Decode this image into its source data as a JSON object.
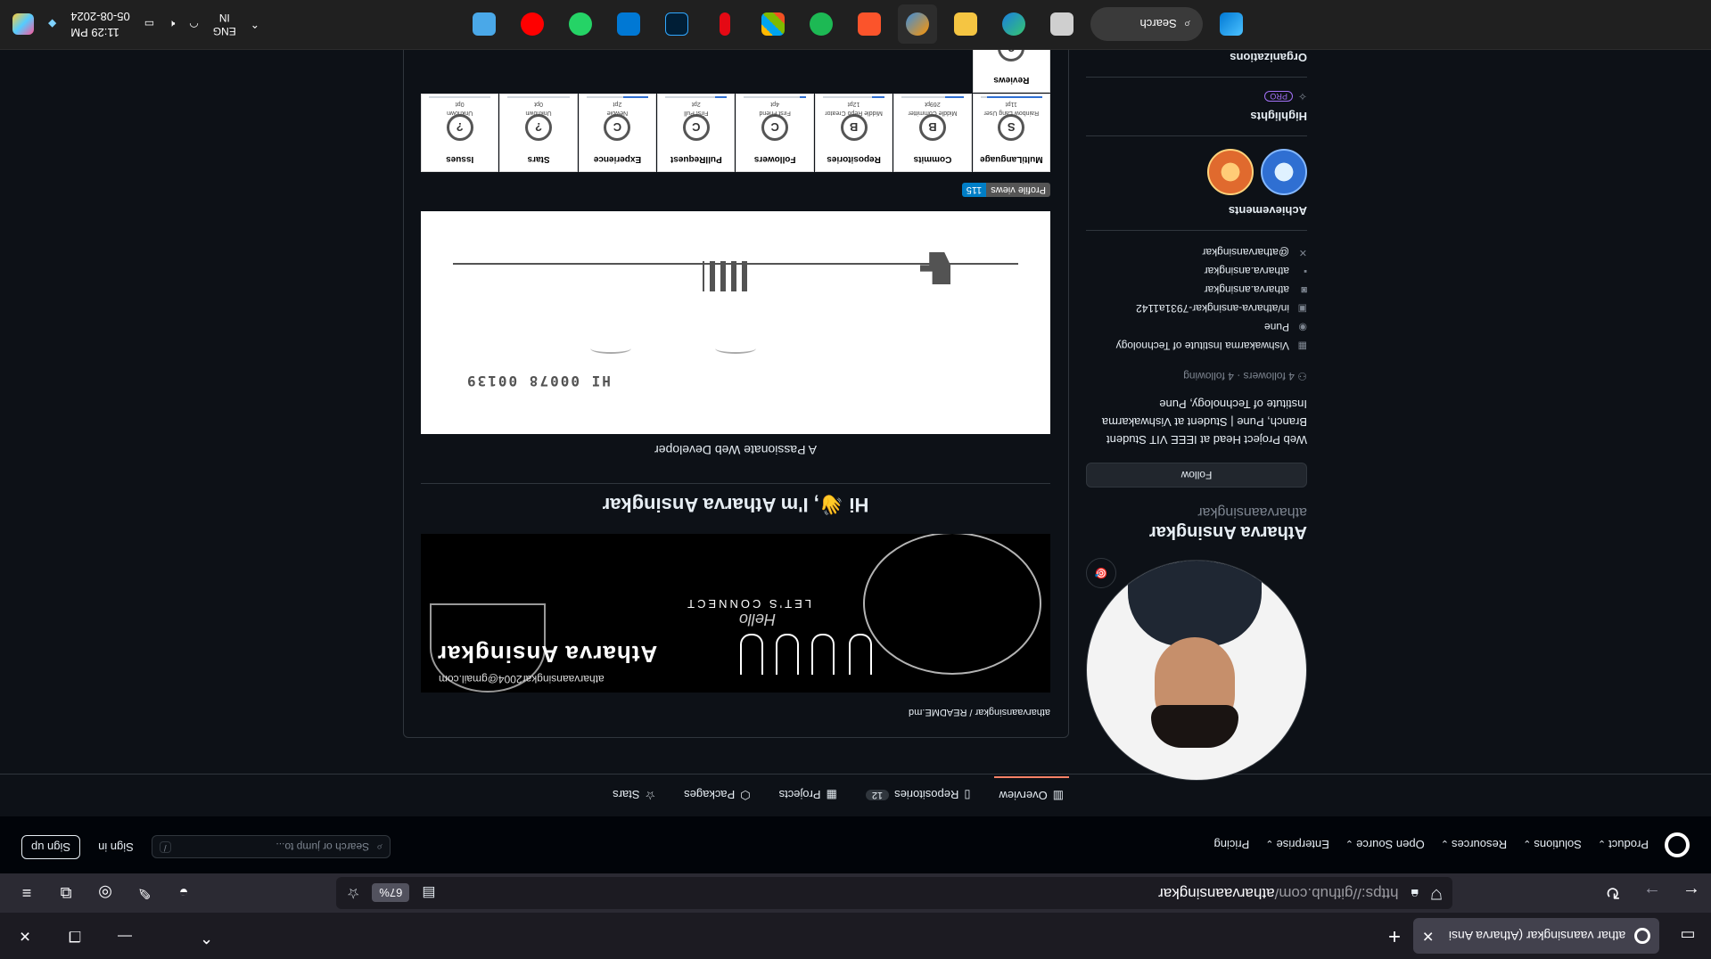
{
  "browser": {
    "tab_title": "athar vaansingkar (Atharva Ansi",
    "tab_close": "✕",
    "new_tab": "+",
    "url_host": "https://github.com/",
    "url_path": "atharvaansingkar",
    "zoom": "67%"
  },
  "github_header": {
    "menu": [
      "Product",
      "Solutions",
      "Resources",
      "Open Source",
      "Enterprise",
      "Pricing"
    ],
    "search_placeholder": "Search or jump to...",
    "search_kbd": "/",
    "sign_in": "Sign in",
    "sign_up": "Sign up"
  },
  "profile_tabs": [
    {
      "label": "Overview",
      "icon": "book-icon"
    },
    {
      "label": "Repositories",
      "icon": "repo-icon",
      "count": "12"
    },
    {
      "label": "Projects",
      "icon": "table-icon"
    },
    {
      "label": "Packages",
      "icon": "package-icon"
    },
    {
      "label": "Stars",
      "icon": "star-icon"
    }
  ],
  "profile": {
    "name": "Atharva Ansingkar",
    "login": "atharvaansingkar",
    "status_emoji": "🎯",
    "follow_label": "Follow",
    "bio": "Web Project Head at IEEE VIT Student Branch, Pune | Student at Vishwakarma Institute of Technology, Pune",
    "followers": "4 followers",
    "following": "4 following",
    "details": [
      {
        "icon": "building-icon",
        "text": "Vishwakarma Institute of Technology"
      },
      {
        "icon": "location-icon",
        "text": "Pune"
      },
      {
        "icon": "linkedin-icon",
        "text": "in/atharva-ansingkar-7931a1142"
      },
      {
        "icon": "instagram-icon",
        "text": "atharva.ansingkar"
      },
      {
        "icon": "facebook-icon",
        "text": "atharva.ansingkar"
      },
      {
        "icon": "x-icon",
        "text": "@atharvansingkar"
      }
    ],
    "achievements_title": "Achievements",
    "highlights_title": "Highlights",
    "pro_label": "PRO",
    "organizations_title": "Organizations"
  },
  "readme": {
    "path": "atharvaansingkar / README.md",
    "banner_name": "Atharva Ansingkar",
    "banner_email": "atharvaansingkar2004@gmail.com",
    "banner_connect": "LET'S CONNECT",
    "banner_hello": "Hello",
    "heading": "Hi 👋, I'm Atharva Ansingkar",
    "tagline": "A Passionate Web Developer",
    "game_score": "HI 00078  00139",
    "views_label": "Profile views",
    "views_count": "115",
    "trophies": [
      {
        "name": "MultiLanguage",
        "rank": "S",
        "sub": "Rainbow Lang User",
        "pts": "11pt",
        "progress": 0.9
      },
      {
        "name": "Commits",
        "rank": "B",
        "sub": "Middle Committer",
        "pts": "269pt",
        "progress": 0.3
      },
      {
        "name": "Repositories",
        "rank": "B",
        "sub": "Middle Repo Creator",
        "pts": "12pt",
        "progress": 0.2
      },
      {
        "name": "Followers",
        "rank": "C",
        "sub": "First Friend",
        "pts": "4pt",
        "progress": 0.1
      },
      {
        "name": "PullRequest",
        "rank": "C",
        "sub": "First Pull",
        "pts": "2pt",
        "progress": 0.2
      },
      {
        "name": "Experience",
        "rank": "C",
        "sub": "Newbie",
        "pts": "2pt",
        "progress": 0.4
      },
      {
        "name": "Stars",
        "rank": "?",
        "sub": "Unknown",
        "pts": "0pt",
        "progress": 0
      },
      {
        "name": "Issues",
        "rank": "?",
        "sub": "Unknown",
        "pts": "0pt",
        "progress": 0
      },
      {
        "name": "Reviews",
        "rank": "?",
        "sub": "",
        "pts": "",
        "progress": 0
      }
    ]
  },
  "taskbar": {
    "search_label": "Search",
    "lang_line1": "ENG",
    "lang_line2": "IN",
    "time": "11:29 PM",
    "date": "05-08-2024"
  }
}
